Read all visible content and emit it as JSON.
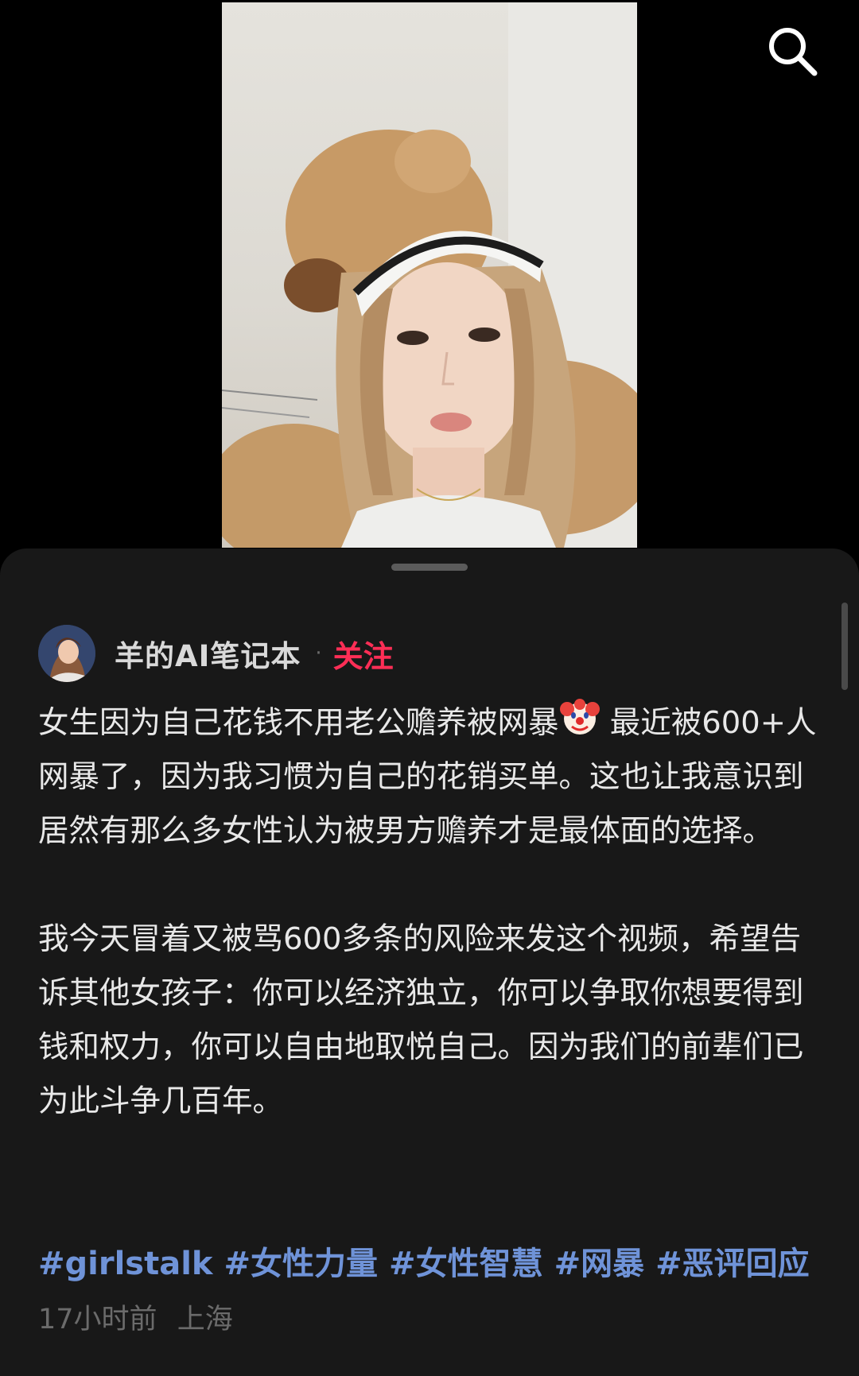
{
  "author": {
    "name": "羊的AI笔记本",
    "separator": "·",
    "follow_label": "关注"
  },
  "post": {
    "para1_before_emoji": "女生因为自己花钱不用老公赡养被网暴",
    "emoji_icon": "clown-face-icon",
    "para1_after_emoji": " 最近被600+人网暴了，因为我习惯为自己的花销买单。这也让我意识到居然有那么多女性认为被男方赡养才是最体面的选择。",
    "para2": "我今天冒着又被骂600多条的风险来发这个视频，希望告诉其他女孩子：你可以经济独立，你可以争取你想要得到钱和权力，你可以自由地取悦自己。因为我们的前辈们已为此斗争几百年。"
  },
  "tags": [
    "#girlstalk",
    "#女性力量",
    "#女性智慧",
    "#网暴",
    "#恶评回应"
  ],
  "meta": {
    "time": "17小时前",
    "location": "上海"
  },
  "colors": {
    "accent_follow": "#ff2e56",
    "tag": "#6f93d8",
    "sheet_background": "#181818"
  },
  "icons": {
    "search": "search-icon"
  }
}
